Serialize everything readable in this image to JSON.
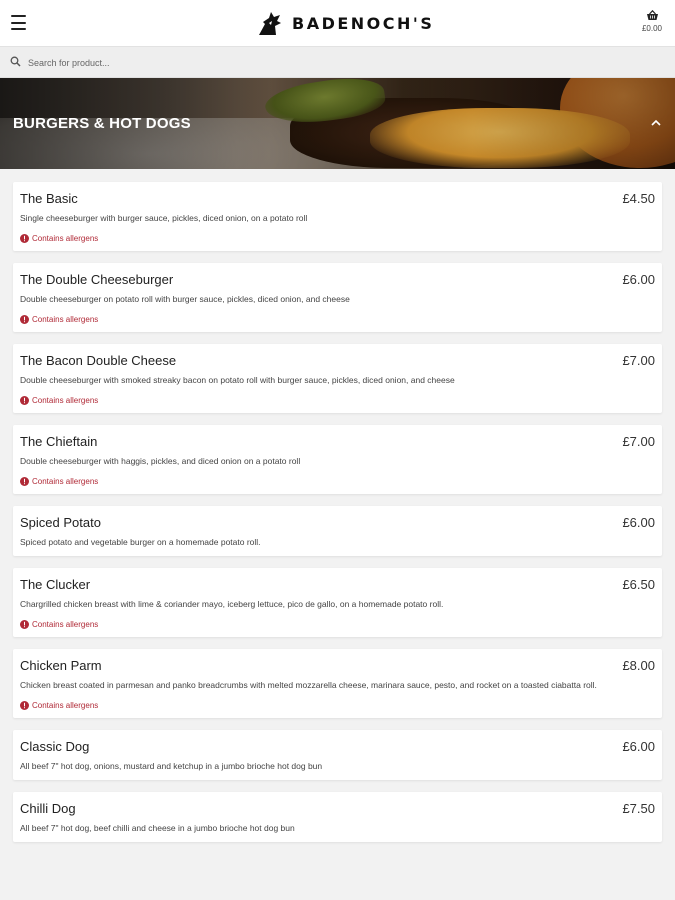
{
  "header": {
    "brand_name": "BADENOCH'S",
    "cart_total": "£0.00"
  },
  "search": {
    "placeholder": "Search for product..."
  },
  "category": {
    "title": "BURGERS & HOT DOGS"
  },
  "colors": {
    "allergen": "#b02a37",
    "background": "#f2f2f2"
  },
  "items": [
    {
      "name": "The Basic",
      "price": "£4.50",
      "description": "Single cheeseburger with burger sauce, pickles, diced onion, on a potato roll",
      "allergen": "Contains allergens"
    },
    {
      "name": "The Double Cheeseburger",
      "price": "£6.00",
      "description": "Double cheeseburger on potato roll with burger sauce, pickles, diced onion, and cheese",
      "allergen": "Contains allergens"
    },
    {
      "name": "The Bacon Double Cheese",
      "price": "£7.00",
      "description": "Double cheeseburger with smoked streaky bacon on potato roll with burger sauce, pickles, diced onion, and cheese",
      "allergen": "Contains allergens"
    },
    {
      "name": "The Chieftain",
      "price": "£7.00",
      "description": "Double cheeseburger with haggis, pickles, and diced onion on a potato roll",
      "allergen": "Contains allergens"
    },
    {
      "name": "Spiced Potato",
      "price": "£6.00",
      "description": "Spiced potato and vegetable burger on a homemade potato roll.",
      "allergen": null
    },
    {
      "name": "The Clucker",
      "price": "£6.50",
      "description": "Chargrilled chicken breast with lime & coriander mayo, iceberg lettuce, pico de gallo, on a homemade potato roll.",
      "allergen": "Contains allergens"
    },
    {
      "name": "Chicken Parm",
      "price": "£8.00",
      "description": "Chicken breast coated in parmesan and panko breadcrumbs with melted mozzarella cheese, marinara sauce, pesto, and rocket on a toasted ciabatta roll.",
      "allergen": "Contains allergens"
    },
    {
      "name": "Classic Dog",
      "price": "£6.00",
      "description": "All beef 7\" hot dog, onions, mustard and ketchup in a jumbo brioche hot dog bun",
      "allergen": null
    },
    {
      "name": "Chilli Dog",
      "price": "£7.50",
      "description": "All beef 7\" hot dog, beef chilli and cheese in a jumbo brioche hot dog bun",
      "allergen": null
    }
  ]
}
